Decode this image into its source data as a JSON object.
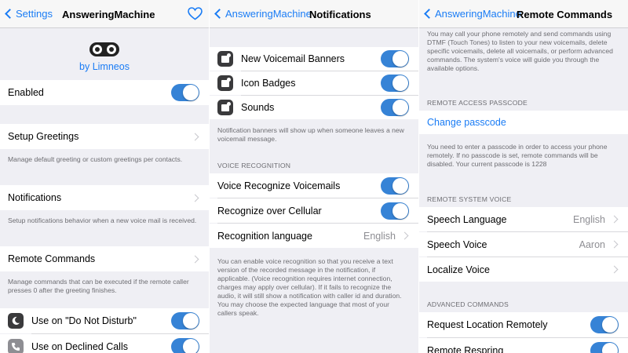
{
  "colors": {
    "accent": "#1a7cf5",
    "toggle_on": "#3683d6",
    "background": "#efeff4"
  },
  "screen1": {
    "back_label": "Settings",
    "title": "AnsweringMachine",
    "by_label": "by Limneos",
    "enabled_label": "Enabled",
    "enabled_on": true,
    "setup_greetings_label": "Setup Greetings",
    "setup_greetings_note": "Manage default greeting or custom greetings per contacts.",
    "notifications_label": "Notifications",
    "notifications_note": "Setup notifications behavior when a new voice mail is received.",
    "remote_commands_label": "Remote Commands",
    "remote_commands_note": "Manage commands that can be executed if the remote caller presses 0 after the greeting finishes.",
    "dnd_label": "Use on \"Do Not Disturb\"",
    "declined_label": "Use on Declined Calls"
  },
  "screen2": {
    "back_label": "AnsweringMachine",
    "title": "Notifications",
    "banners_label": "New Voicemail Banners",
    "badges_label": "Icon Badges",
    "sounds_label": "Sounds",
    "banners_note": "Notification banners will show up when someone leaves a new voicemail message.",
    "voice_recognition_header": "VOICE RECOGNITION",
    "recognize_voicemails_label": "Voice Recognize Voicemails",
    "recognize_cellular_label": "Recognize over Cellular",
    "recognition_language_label": "Recognition language",
    "recognition_language_value": "English",
    "recognition_note": "You can enable voice recognition so that you receive a text version of the recorded message in the notification, if applicable. (Voice recognition requires internet connection, charges may apply over cellular). If it fails to recognize the audio, it will still show a notification with caller id and duration. You may choose the expected language that most of your callers speak."
  },
  "screen3": {
    "back_label": "AnsweringMachine",
    "title": "Remote Commands",
    "intro_note": "You may call your phone remotely and send commands using DTMF (Touch Tones) to listen to your new voicemails, delete specific voicemails, delete all voicemails, or perform advanced commands. The system's voice will guide you through the available options.",
    "passcode_header": "REMOTE ACCESS PASSCODE",
    "change_passcode_label": "Change passcode",
    "passcode_note": "You need to enter a passcode in order to access your phone remotely. If no passcode is set, remote commands will be disabled. Your current passcode is 1228",
    "system_voice_header": "REMOTE SYSTEM VOICE",
    "speech_language_label": "Speech Language",
    "speech_language_value": "English",
    "speech_voice_label": "Speech Voice",
    "speech_voice_value": "Aaron",
    "localize_voice_label": "Localize Voice",
    "advanced_header": "ADVANCED COMMANDS",
    "request_location_label": "Request Location Remotely",
    "remote_respring_label": "Remote Respring"
  }
}
